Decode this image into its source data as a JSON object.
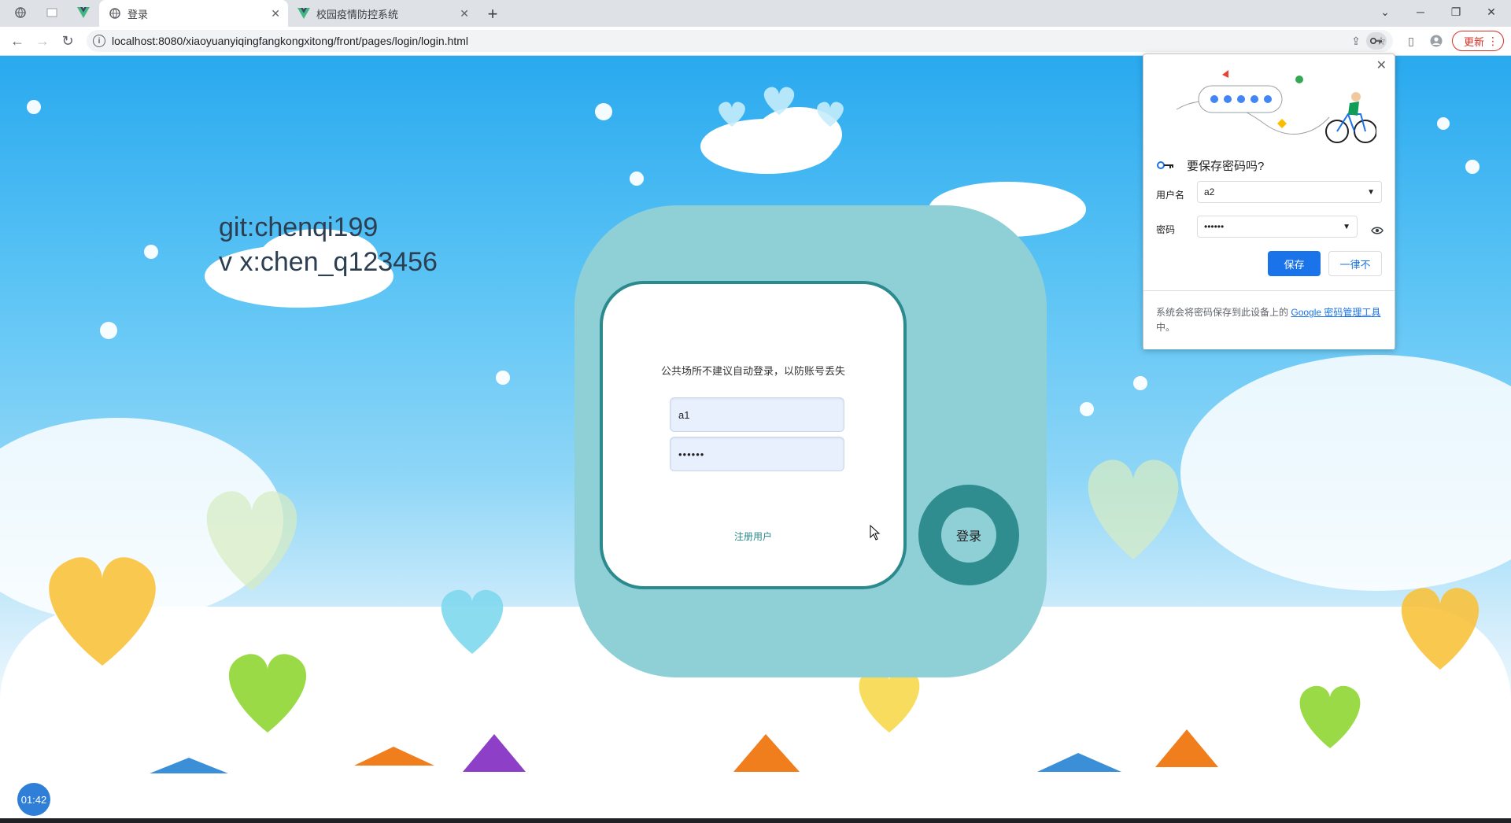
{
  "browser": {
    "tabs": [
      {
        "label": "",
        "icon": "globe-icon"
      },
      {
        "label": "",
        "icon": "page-icon"
      },
      {
        "label": "",
        "icon": "vue-icon"
      },
      {
        "label": "登录",
        "icon": "globe-icon",
        "active": true
      },
      {
        "label": "校园疫情防控系统",
        "icon": "vue-icon"
      }
    ],
    "url": "localhost:8080/xiaoyuanyiqingfangkongxitong/front/pages/login/login.html",
    "update_label": "更新"
  },
  "page": {
    "watermark_line1": "git:chenqi199",
    "watermark_line2": "v x:chen_q123456",
    "notice": "公共场所不建议自动登录，以防账号丢失",
    "username_value": "a1",
    "password_value": "••••••",
    "register_label": "注册用户",
    "login_label": "登录",
    "timer": "01:42"
  },
  "password_popup": {
    "title": "要保存密码吗?",
    "username_label": "用户名",
    "username_value": "a2",
    "password_label": "密码",
    "password_value": "••••••",
    "save_label": "保存",
    "never_label": "一律不",
    "footer_text": "系统会将密码保存到此设备上的",
    "footer_link": "Google 密码管理工具",
    "footer_suffix": "中。"
  },
  "colors": {
    "accent_teal": "#2b8a8d",
    "panel_teal": "#8fcfd6",
    "chrome_blue": "#1a73e8"
  }
}
